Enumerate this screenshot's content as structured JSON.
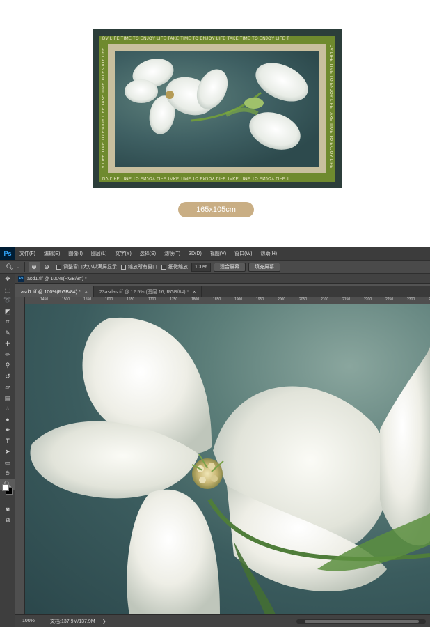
{
  "product": {
    "border_text": "DV LIFE TIME TO ENJOY LIFE TAKE TIME TO ENJOY LIFE TAKE TIME TO ENJOY LIFE T",
    "size_label": "165x105cm"
  },
  "photoshop": {
    "logo": "Ps",
    "menu": [
      "文件(F)",
      "编辑(E)",
      "图像(I)",
      "图层(L)",
      "文字(Y)",
      "选择(S)",
      "滤镜(T)",
      "3D(D)",
      "视图(V)",
      "窗口(W)",
      "帮助(H)"
    ],
    "options": {
      "resize_windows": "调整窗口大小以满屏显示",
      "zoom_all": "缩放所有窗口",
      "scrubby_zoom": "细微缩放",
      "zoom_value": "100%",
      "fit_screen": "适合屏幕",
      "fill_screen": "填充屏幕"
    },
    "panel_tab": "asd1.tif @ 100%(RGB/8#) *",
    "doc_tabs": [
      {
        "label": "asd1.tif @ 100%(RGB/8#) *",
        "active": true
      },
      {
        "label": "23asdas.tif @ 12.5% (图层 16, RGB/8#) *",
        "active": false
      }
    ],
    "ruler_h": [
      "1450",
      "1500",
      "1550",
      "1600",
      "1650",
      "1700",
      "1750",
      "1800",
      "1850",
      "1900",
      "1950",
      "2000",
      "2050",
      "2100",
      "2150",
      "2200",
      "2250",
      "2300",
      "2350"
    ],
    "status": {
      "zoom": "100%",
      "doc": "文档:137.9M/137.9M"
    }
  }
}
